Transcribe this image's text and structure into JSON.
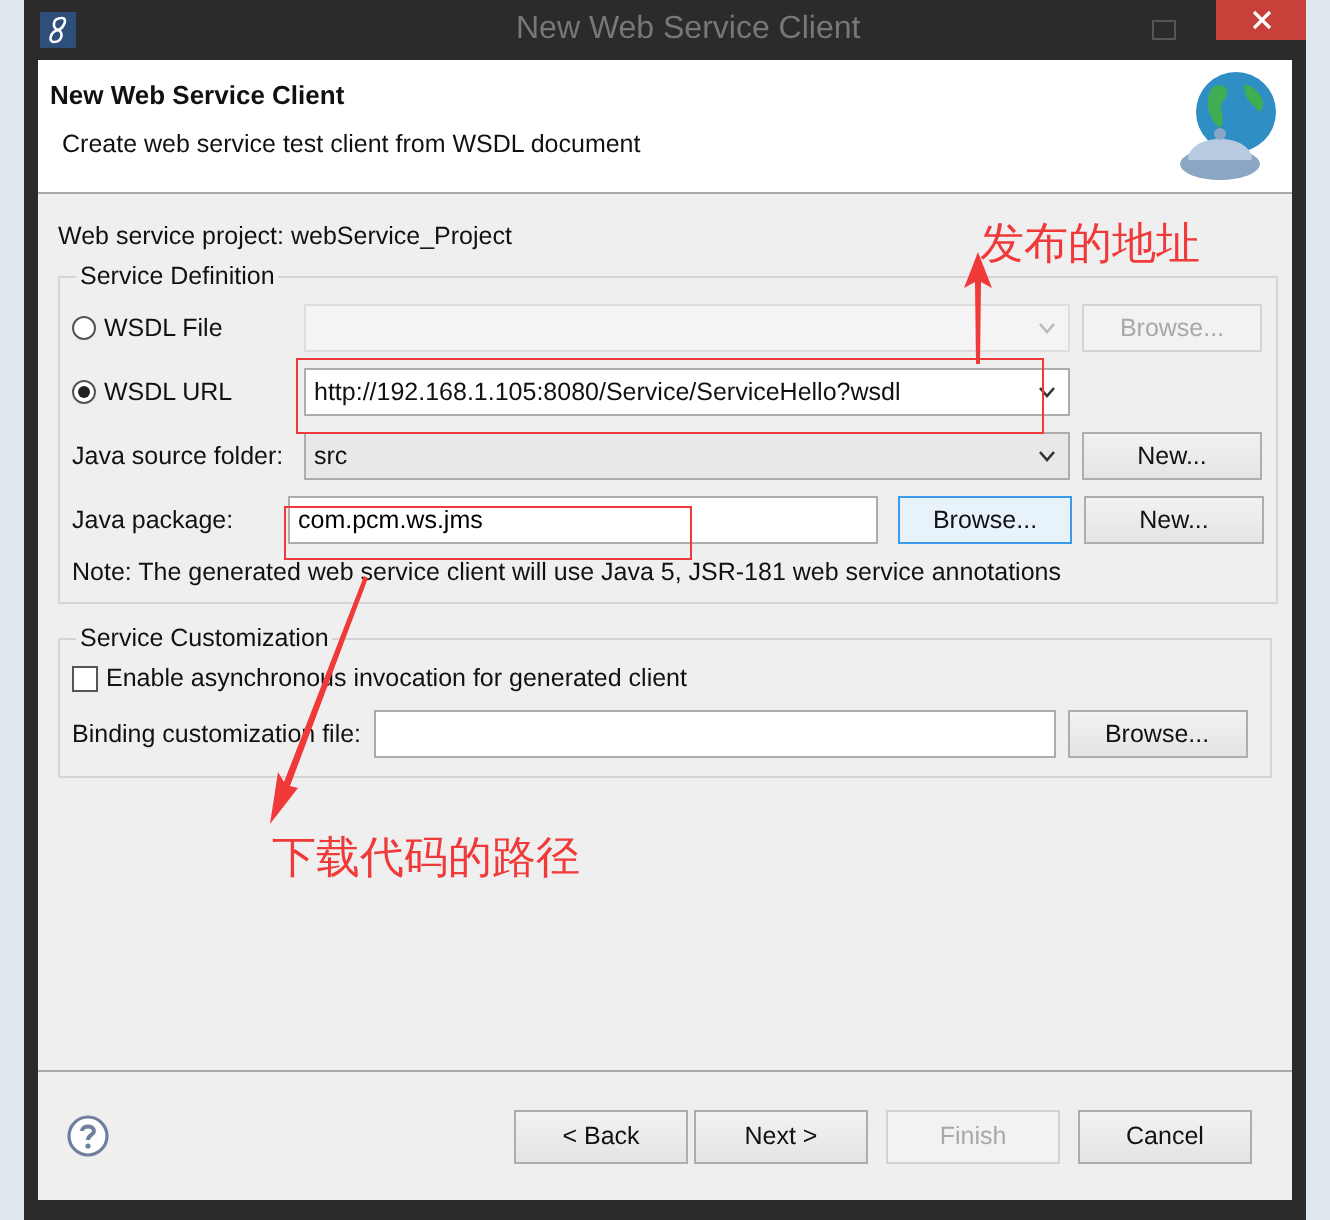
{
  "window": {
    "title": "New Web Service Client",
    "active": false
  },
  "header": {
    "title": "New Web Service Client",
    "description": "Create web service test client from WSDL document"
  },
  "project_label": "Web service project: webService_Project",
  "service_definition": {
    "legend": "Service Definition",
    "sources": [
      {
        "label": "WSDL File",
        "selected": false,
        "button": "Browse..."
      },
      {
        "label": "WSDL URL",
        "selected": true,
        "value": "http://192.168.1.105:8080/Service/ServiceHello?wsdl"
      }
    ],
    "source_folder": {
      "label": "Java source folder:",
      "value": "src",
      "button": "New..."
    },
    "package": {
      "label": "Java package:",
      "value": "com.pcm.ws.jms",
      "buttons": [
        {
          "label": "Browse...",
          "focused": true
        },
        {
          "label": "New...",
          "focused": false
        }
      ]
    },
    "note": "Note: The generated web service client will use Java 5, JSR-181 web service annotations"
  },
  "customization": {
    "legend": "Service Customization",
    "async": {
      "label": "Enable asynchronous invocation for generated client",
      "checked": false
    },
    "binding": {
      "label": "Binding customization file:",
      "button": "Browse..."
    }
  },
  "buttons": [
    {
      "label": "< Back",
      "disabled": false
    },
    {
      "label": "Next >",
      "disabled": false
    },
    {
      "label": "Finish",
      "disabled": true
    },
    {
      "label": "Cancel",
      "disabled": false
    }
  ],
  "annotations": [
    {
      "kind": "up",
      "text": "发布的地址"
    },
    {
      "kind": "down",
      "text": "下载代码的路径"
    }
  ]
}
